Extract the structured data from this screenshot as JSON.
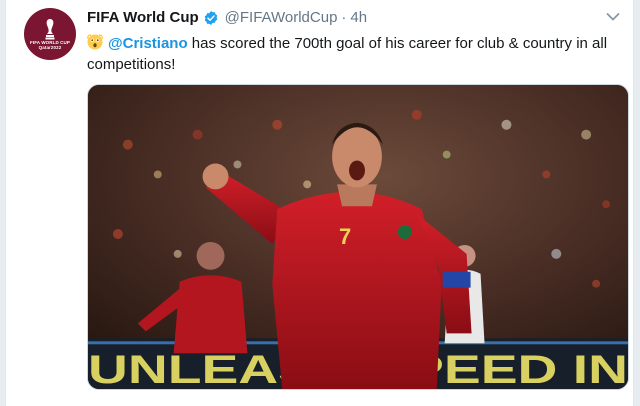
{
  "tweet": {
    "display_name": "FIFA World Cup",
    "handle": "@FIFAWorldCup",
    "separator": "·",
    "time": "4h",
    "mention": "@Cristiano",
    "text": " has scored the 700th goal of his career for club & country in all competitions!",
    "emoji": "astonished-face-emoji"
  },
  "avatar": {
    "label": "FIFA WORLD CUP",
    "sublabel": "Qatar2022",
    "color": "#7a1532"
  },
  "media": {
    "board_text": "UNLEASH SPEED IN",
    "jersey_number": "7"
  },
  "colors": {
    "link": "#1b95e0",
    "verified": "#1da1f2",
    "secondary_text": "#657786"
  }
}
